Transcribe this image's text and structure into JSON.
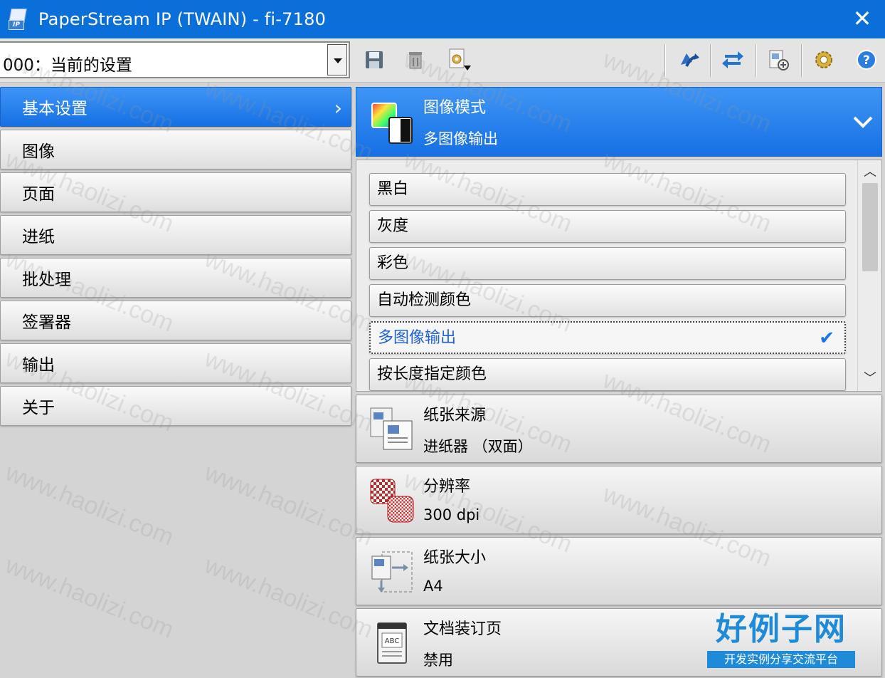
{
  "window": {
    "title": "PaperStream IP (TWAIN) - fi-7180",
    "close_glyph": "✕"
  },
  "toolbar": {
    "profile_select": {
      "value": "000：当前的设置"
    },
    "buttons": [
      {
        "name": "save-icon"
      },
      {
        "name": "delete-icon"
      },
      {
        "name": "profile-settings-icon"
      },
      {
        "name": "scan-icon"
      },
      {
        "name": "swap-icon"
      },
      {
        "name": "preview-icon"
      },
      {
        "name": "gear-icon"
      },
      {
        "name": "help-icon"
      }
    ]
  },
  "nav": {
    "items": [
      {
        "label": "基本设置",
        "active": true
      },
      {
        "label": "图像"
      },
      {
        "label": "页面"
      },
      {
        "label": "进纸"
      },
      {
        "label": "批处理"
      },
      {
        "label": "签署器"
      },
      {
        "label": "输出"
      },
      {
        "label": "关于"
      }
    ],
    "chevron": "›"
  },
  "image_mode": {
    "title": "图像模式",
    "value": "多图像输出",
    "options": [
      {
        "label": "黑白"
      },
      {
        "label": "灰度"
      },
      {
        "label": "彩色"
      },
      {
        "label": "自动检测颜色"
      },
      {
        "label": "多图像输出",
        "selected": true
      },
      {
        "label": "按长度指定颜色"
      }
    ],
    "check_glyph": "✔"
  },
  "settings": {
    "paper_source": {
      "title": "纸张来源",
      "value": "进纸器 （双面）"
    },
    "resolution": {
      "title": "分辨率",
      "value": "300 dpi"
    },
    "paper_size": {
      "title": "纸张大小",
      "value": "A4"
    },
    "document_binding": {
      "title": "文档装订页",
      "value": "禁用"
    }
  },
  "watermark": {
    "text": "www.haolizi.com"
  },
  "brand": {
    "title": "好例子网",
    "subtitle": "开发实例分享交流平台"
  },
  "colors": {
    "accent": "#1670e4",
    "title_bar": "#0a6fd8",
    "selected_text": "#1f62d8"
  }
}
